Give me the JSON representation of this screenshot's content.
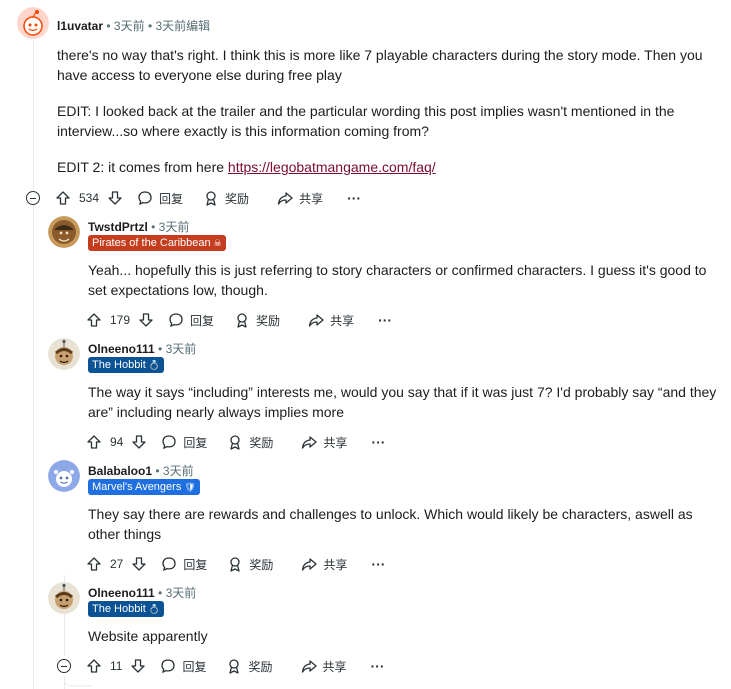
{
  "colors": {
    "meta_text": "#576f76",
    "link": "#7a0c2e",
    "flair_pirates": "#c53d1e",
    "flair_hobbit": "#0b5394",
    "flair_avengers": "#1f6fe0"
  },
  "comments": [
    {
      "username": "l1uvatar",
      "time": "3天前",
      "edited": "3天前编辑",
      "body": [
        "there's no way that's right. I think this is more like 7 playable characters during the story mode. Then you have access to everyone else during free play",
        "EDIT: I looked back at the trailer and the particular wording this post implies wasn't mentioned in the interview...so where exactly is this information coming from?"
      ],
      "edit2_prefix": "EDIT 2: it comes from here ",
      "edit2_link": "https://legobatmangame.com/faq/",
      "votes": "534",
      "reply": "回复",
      "award": "奖励",
      "share": "共享",
      "more": "···"
    },
    {
      "username": "TwstdPrtzl",
      "time": "3天前",
      "flair": "Pirates of the Caribbean",
      "flair_emoji": "☠",
      "body": "Yeah... hopefully this is just referring to story characters or confirmed characters. I guess it's good to set expectations low, though.",
      "votes": "179",
      "reply": "回复",
      "award": "奖励",
      "share": "共享",
      "more": "···"
    },
    {
      "username": "Olneeno111",
      "time": "3天前",
      "flair": "The Hobbit",
      "flair_emoji": "💍",
      "body": "The way it says “including” interests me, would you say that if it was just 7? I'd probably say “and they are” including nearly always implies more",
      "votes": "94",
      "reply": "回复",
      "award": "奖励",
      "share": "共享",
      "more": "···"
    },
    {
      "username": "Balabaloo1",
      "time": "3天前",
      "flair": "Marvel's Avengers",
      "flair_emoji": "🛡",
      "body": "They say there are rewards and challenges to unlock. Which would likely be characters, aswell as other things",
      "votes": "27",
      "reply": "回复",
      "award": "奖励",
      "share": "共享",
      "more": "···"
    },
    {
      "username": "Olneeno111",
      "time": "3天前",
      "flair": "The Hobbit",
      "flair_emoji": "💍",
      "body": "Website apparently",
      "votes": "11",
      "reply": "回复",
      "award": "奖励",
      "share": "共享",
      "more": "···"
    }
  ],
  "icons": [
    "upvote-icon",
    "downvote-icon",
    "reply-icon",
    "award-icon",
    "share-icon",
    "more-icon",
    "collapse-icon"
  ]
}
